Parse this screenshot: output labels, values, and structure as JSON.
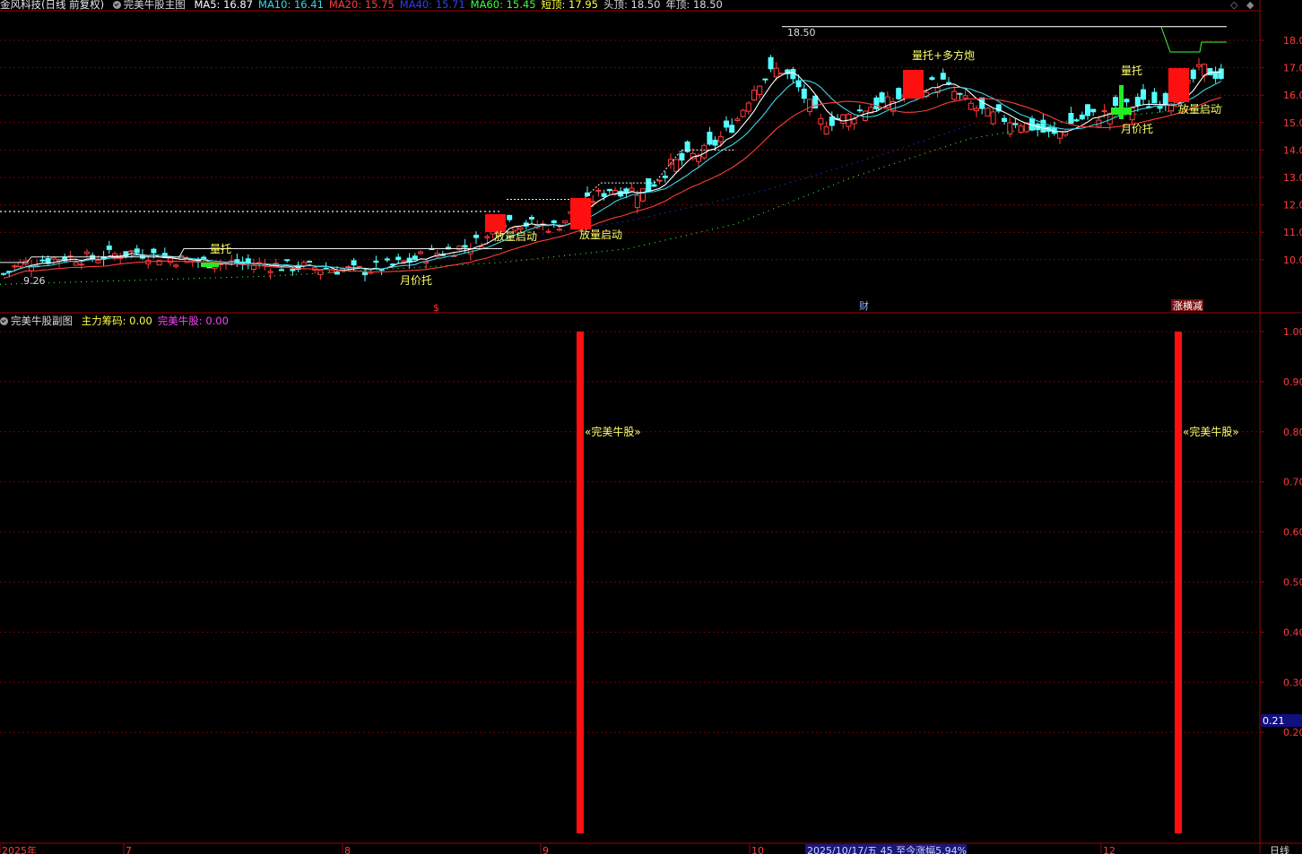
{
  "main_header": {
    "title": "金风科技(日线 前复权)",
    "indicator_name": "完美牛股主图",
    "items": [
      {
        "label": "MA5: 16.87",
        "color": "#ffffff"
      },
      {
        "label": "MA10: 16.41",
        "color": "#39d7e8"
      },
      {
        "label": "MA20: 15.75",
        "color": "#ff3c3c"
      },
      {
        "label": "MA40: 15.71",
        "color": "#2f3cff"
      },
      {
        "label": "MA60: 15.45",
        "color": "#3cff3c"
      },
      {
        "label": "短顶: 17.95",
        "color": "#ffff40"
      },
      {
        "label": "头顶: 18.50",
        "color": "#dddddd"
      },
      {
        "label": "年顶: 18.50",
        "color": "#dddddd"
      }
    ]
  },
  "sub_header": {
    "indicator_name": "完美牛股副图",
    "items": [
      {
        "label": "主力筹码: 0.00",
        "color": "#ffff40"
      },
      {
        "label": "完美牛股: 0.00",
        "color": "#ff40ff"
      }
    ]
  },
  "main_axis": {
    "ticks": [
      "18.00",
      "17.00",
      "16.00",
      "15.00",
      "14.00",
      "13.00",
      "12.00",
      "11.00",
      "10.00"
    ],
    "tick_values": [
      18,
      17,
      16,
      15,
      14,
      13,
      12,
      11,
      10
    ]
  },
  "sub_axis": {
    "ticks": [
      "1.00",
      "0.90",
      "0.80",
      "0.70",
      "0.60",
      "0.50",
      "0.40",
      "0.30",
      "0.20"
    ],
    "tick_values": [
      1.0,
      0.9,
      0.8,
      0.7,
      0.6,
      0.5,
      0.4,
      0.3,
      0.2
    ],
    "current_value": "0.21"
  },
  "price_markers": {
    "high": "18.50",
    "low": "9.26"
  },
  "annotations": [
    {
      "text": "量托",
      "color": "#ffff66"
    },
    {
      "text": "放量启动",
      "color": "#ffff66"
    },
    {
      "text": "放量启动",
      "color": "#ffff66"
    },
    {
      "text": "月价托",
      "color": "#ffff66"
    },
    {
      "text": "量托+多方炮",
      "color": "#ffff66"
    },
    {
      "text": "量托",
      "color": "#ffff66"
    },
    {
      "text": "月价托",
      "color": "#ffff66"
    },
    {
      "text": "放量启动",
      "color": "#ffff66"
    }
  ],
  "event_markers": [
    {
      "text": "$",
      "color": "#ff3030"
    },
    {
      "text": "财",
      "color": "#8fb4ff"
    },
    {
      "text": "涨横减",
      "color": "#ffffff"
    }
  ],
  "sub_signals": [
    {
      "label": "«完美牛股»",
      "value": 1.0
    },
    {
      "label": "«完美牛股»",
      "value": 1.0
    }
  ],
  "x_axis": {
    "labels": [
      "2025年",
      "7",
      "8",
      "9",
      "10",
      "12"
    ],
    "info_bar": "2025/10/17/五 45 至今涨幅5.94%",
    "period": "日线"
  },
  "colors": {
    "up": "#ff3c3c",
    "down": "#54ffff",
    "grid": "#7a0000",
    "ma5": "#ffffff",
    "ma10": "#39d7e8",
    "ma20": "#ff3c3c"
  }
}
